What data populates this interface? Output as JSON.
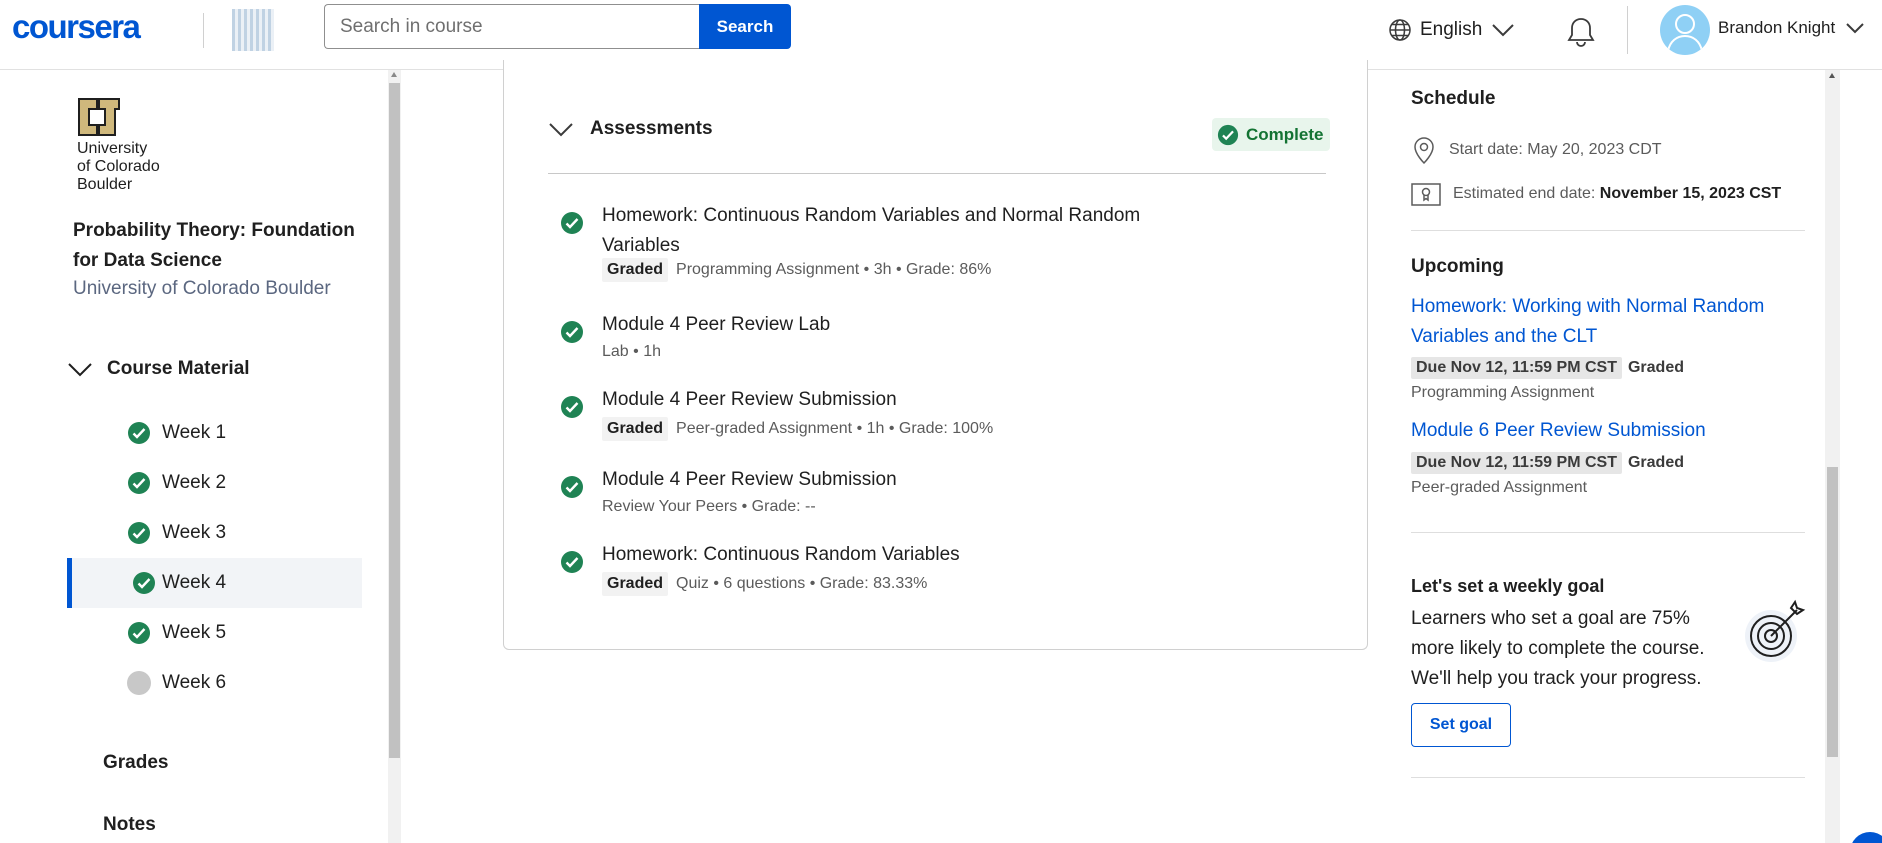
{
  "header": {
    "logo_text": "coursera",
    "search": {
      "placeholder": "Search in course",
      "button_label": "Search"
    },
    "language": "English",
    "user_name": "Brandon Knight"
  },
  "sidebar": {
    "university_logo_lines": [
      "University",
      "of Colorado",
      "Boulder"
    ],
    "course_title": "Probability Theory: Foundation for Data Science",
    "course_org": "University of Colorado Boulder",
    "course_material_label": "Course Material",
    "weeks": [
      {
        "label": "Week 1",
        "status": "complete"
      },
      {
        "label": "Week 2",
        "status": "complete"
      },
      {
        "label": "Week 3",
        "status": "complete"
      },
      {
        "label": "Week 4",
        "status": "complete",
        "selected": true
      },
      {
        "label": "Week 5",
        "status": "complete"
      },
      {
        "label": "Week 6",
        "status": "incomplete"
      }
    ],
    "links": [
      "Grades",
      "Notes"
    ]
  },
  "assessments": {
    "heading": "Assessments",
    "status_badge": "Complete",
    "items": [
      {
        "title": "Homework: Continuous Random Variables and Normal Random Variables",
        "graded_tag": "Graded",
        "meta": "Programming Assignment • 3h • Grade: 86%"
      },
      {
        "title": "Module 4 Peer Review Lab",
        "graded_tag": "",
        "meta": "Lab • 1h"
      },
      {
        "title": "Module 4 Peer Review Submission",
        "graded_tag": "Graded",
        "meta": "Peer-graded Assignment • 1h • Grade: 100%"
      },
      {
        "title": "Module 4 Peer Review Submission",
        "graded_tag": "",
        "meta": "Review Your Peers • Grade: --"
      },
      {
        "title": "Homework: Continuous Random Variables",
        "graded_tag": "Graded",
        "meta": "Quiz • 6 questions • Grade: 83.33%"
      }
    ]
  },
  "schedule": {
    "heading": "Schedule",
    "start_label": "Start date:",
    "start_value": "May 20, 2023 CDT",
    "end_label": "Estimated end date:",
    "end_value": "November 15, 2023 CST"
  },
  "upcoming": {
    "heading": "Upcoming",
    "items": [
      {
        "title": "Homework: Working with Normal Random Variables and the CLT",
        "due": "Due Nov 12, 11:59 PM CST",
        "graded": "Graded",
        "type": "Programming Assignment"
      },
      {
        "title": "Module 6 Peer Review Submission",
        "due": "Due Nov 12, 11:59 PM CST",
        "graded": "Graded",
        "type": "Peer-graded Assignment"
      }
    ]
  },
  "goal": {
    "heading": "Let's set a weekly goal",
    "body": "Learners who set a goal are 75% more likely to complete the course. We'll help you track your progress.",
    "button_label": "Set goal"
  },
  "colors": {
    "brand": "#0056d2",
    "success": "#1f8354",
    "incomplete": "#c8c8c8"
  }
}
